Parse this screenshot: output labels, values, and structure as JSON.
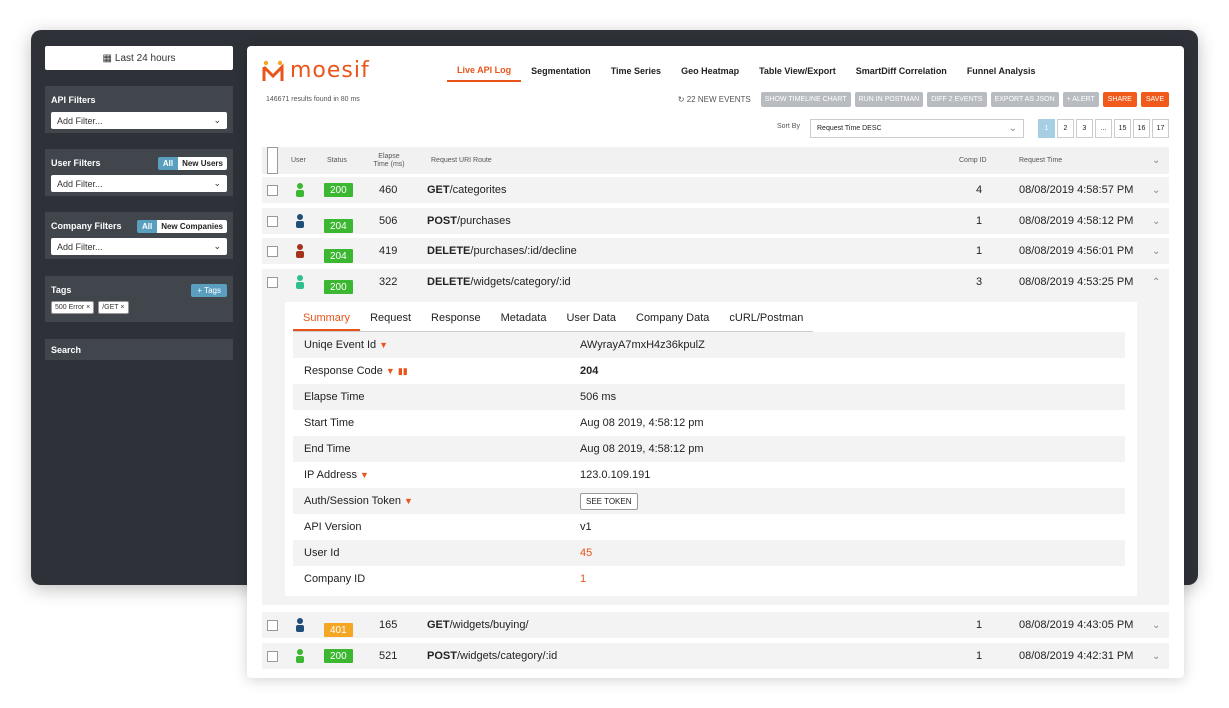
{
  "sidebar": {
    "time_button": "Last 24 hours",
    "api_filters": {
      "label": "API Filters",
      "select": "Add Filter..."
    },
    "user_filters": {
      "label": "User Filters",
      "toggle_all": "All",
      "toggle_other": "New Users",
      "select": "Add Filter..."
    },
    "company_filters": {
      "label": "Company Filters",
      "toggle_all": "All",
      "toggle_other": "New Companies",
      "select": "Add Filter..."
    },
    "tags": {
      "label": "Tags",
      "add_button": "+ Tags",
      "chips": [
        "500 Error",
        "/GET"
      ]
    },
    "search": "Search"
  },
  "header": {
    "logo_text": "moesif",
    "tabs": [
      "Live API Log",
      "Segmentation",
      "Time Series",
      "Geo Heatmap",
      "Table View/Export",
      "SmartDiff Correlation",
      "Funnel Analysis"
    ],
    "results": "146671 results found in 80 ms",
    "new_events": "22 NEW EVENTS",
    "gray_buttons": [
      "SHOW TIMELINE CHART",
      "RUN IN POSTMAN",
      "DIFF 2 EVENTS",
      "EXPORT AS JSON",
      "+ ALERT"
    ],
    "orange_buttons": [
      "SHARE",
      "SAVE"
    ],
    "sort_label": "Sort By",
    "sort_value": "Request Time DESC",
    "pages": [
      "1",
      "2",
      "3",
      "...",
      "15",
      "16",
      "17"
    ]
  },
  "table": {
    "headers": {
      "user": "User",
      "status": "Status",
      "elapse": "Elapse Time (ms)",
      "route": "Request URI Route",
      "comp": "Comp ID",
      "time": "Request Time"
    },
    "rows": [
      {
        "status": "200",
        "elapse": "460",
        "method": "GET",
        "path": "/categorites",
        "comp": "4",
        "time": "08/08/2019 4:58:57 PM"
      },
      {
        "status": "204",
        "elapse": "506",
        "method": "POST",
        "path": "/purchases",
        "comp": "1",
        "time": "08/08/2019 4:58:12 PM"
      },
      {
        "status": "204",
        "elapse": "419",
        "method": "DELETE",
        "path": "/purchases/:id/decline",
        "comp": "1",
        "time": "08/08/2019 4:56:01 PM"
      },
      {
        "status": "200",
        "elapse": "322",
        "method": "DELETE",
        "path": "/widgets/category/:id",
        "comp": "3",
        "time": "08/08/2019 4:53:25 PM"
      },
      {
        "status": "401",
        "elapse": "165",
        "method": "GET",
        "path": "/widgets/buying/",
        "comp": "1",
        "time": "08/08/2019 4:43:05 PM"
      },
      {
        "status": "200",
        "elapse": "521",
        "method": "POST",
        "path": "/widgets/category/:id",
        "comp": "1",
        "time": "08/08/2019 4:42:31 PM"
      }
    ]
  },
  "detail": {
    "tabs": [
      "Summary",
      "Request",
      "Response",
      "Metadata",
      "User Data",
      "Company Data",
      "cURL/Postman"
    ],
    "fields": [
      {
        "key": "Uniqe Event Id",
        "value": "AWyrayA7mxH4z36kpulZ"
      },
      {
        "key": "Response Code",
        "value": "204"
      },
      {
        "key": "Elapse Time",
        "value": "506 ms"
      },
      {
        "key": "Start Time",
        "value": "Aug 08 2019, 4:58:12 pm"
      },
      {
        "key": "End Time",
        "value": "Aug 08 2019, 4:58:12 pm"
      },
      {
        "key": "IP Address",
        "value": "123.0.109.191"
      },
      {
        "key": "Auth/Session Token",
        "value": "SEE TOKEN"
      },
      {
        "key": "API Version",
        "value": "v1"
      },
      {
        "key": "User Id",
        "value": "45"
      },
      {
        "key": "Company ID",
        "value": "1"
      }
    ]
  },
  "colors": {
    "accent": "#e8541a",
    "ok": "#3cb731",
    "warn": "#f5a623",
    "user_green": "#3cb731",
    "user_blue": "#1f4e79",
    "user_red": "#a5321d",
    "user_teal": "#2ebf8f"
  }
}
